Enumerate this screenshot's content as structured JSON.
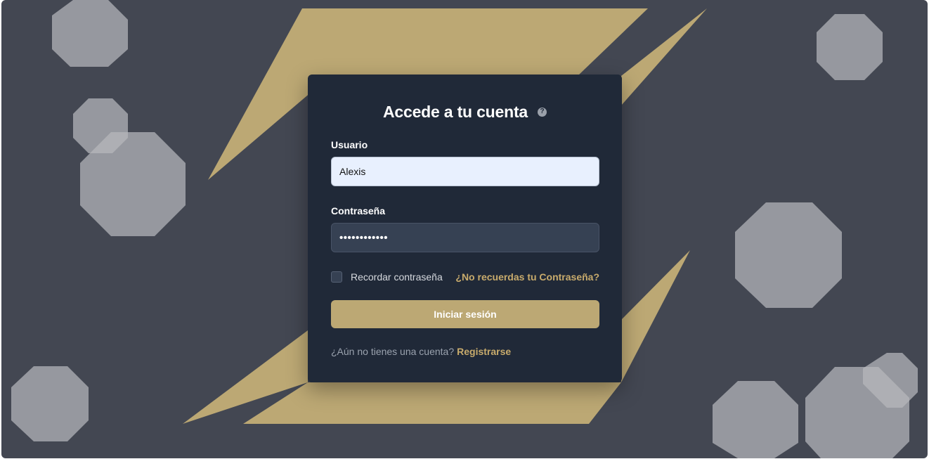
{
  "colors": {
    "background": "#434752",
    "card": "#202938",
    "accent_gold": "#bca874",
    "link_gold": "#c8ab6c",
    "octagon": "#b7b8bd"
  },
  "login": {
    "title": "Accede a tu cuenta",
    "help_icon": "question-circle-icon",
    "help_glyph": "?",
    "username": {
      "label": "Usuario",
      "value": "Alexis"
    },
    "password": {
      "label": "Contraseña",
      "value": "••••••••••••"
    },
    "remember": {
      "label": "Recordar contraseña",
      "checked": false
    },
    "forgot_link": "¿No recuerdas tu Contraseña?",
    "submit_label": "Iniciar sesión",
    "signup_prompt": "¿Aún no tienes una cuenta?",
    "signup_link": "Registrarse"
  }
}
